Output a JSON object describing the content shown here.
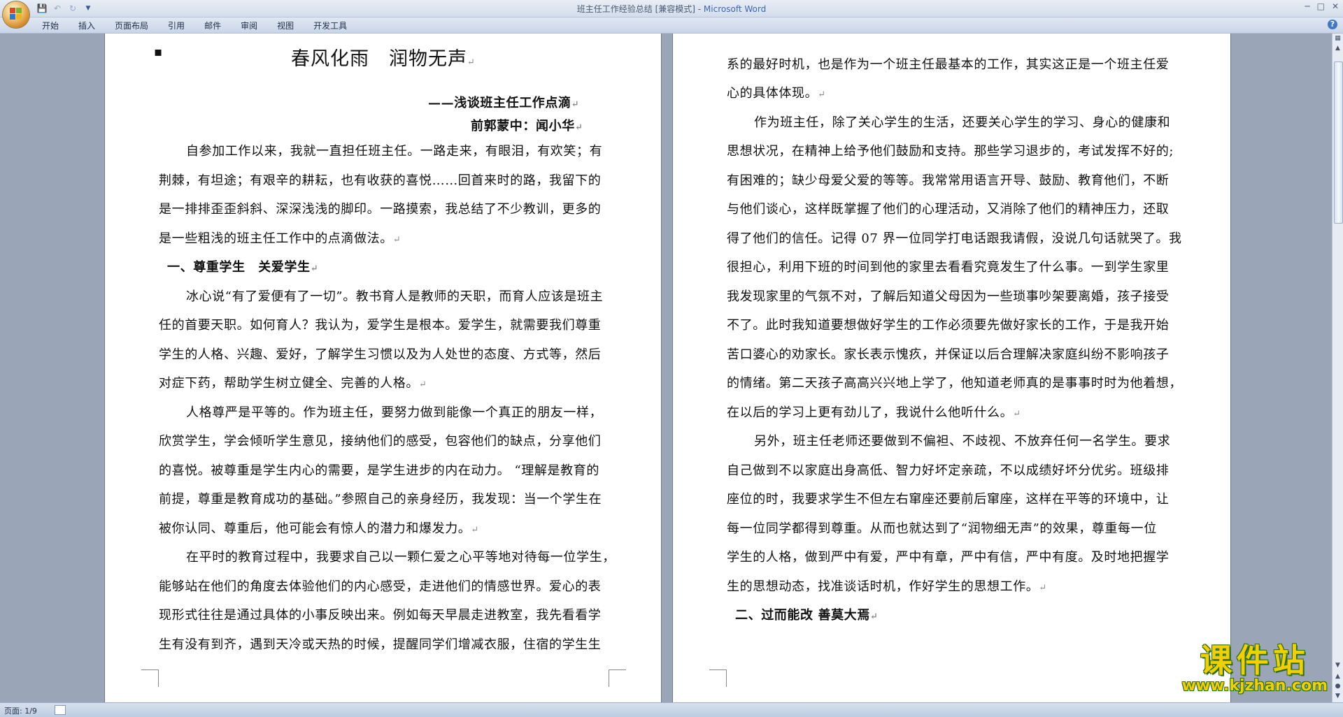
{
  "window": {
    "title_doc": "班主任工作经验总结 [兼容模式] - ",
    "title_app": "Microsoft Word"
  },
  "ribbon": {
    "tabs": [
      "开始",
      "插入",
      "页面布局",
      "引用",
      "邮件",
      "审阅",
      "视图",
      "开发工具"
    ]
  },
  "status": {
    "page": "页面: 1/9"
  },
  "watermark": {
    "text": "课件站",
    "url": "www.kjzhan.com"
  },
  "page_left": {
    "title": "春风化雨　润物无声",
    "subtitle": "——浅谈班主任工作点滴",
    "author": "前郭蒙中：闻小华",
    "lines": [
      "自参加工作以来，我就一直担任班主任。一路走来，有眼泪，有欢笑；有",
      "荆棘，有坦途；有艰辛的耕耘，也有收获的喜悦……回首来时的路，我留下的",
      "是一排排歪歪斜斜、深深浅浅的脚印。一路摸索，我总结了不少教训，更多的",
      "是一些粗浅的班主任工作中的点滴做法。",
      "一、尊重学生　关爱学生",
      "冰心说“有了爱便有了一切”。教书育人是教师的天职，而育人应该是班主",
      "任的首要天职。如何育人？我认为，爱学生是根本。爱学生，就需要我们尊重",
      "学生的人格、兴趣、爱好，了解学生习惯以及为人处世的态度、方式等，然后",
      "对症下药，帮助学生树立健全、完善的人格。",
      "人格尊严是平等的。作为班主任，要努力做到能像一个真正的朋友一样，",
      "欣赏学生，学会倾听学生意见，接纳他们的感受，包容他们的缺点，分享他们",
      "的喜悦。被尊重是学生内心的需要，是学生进步的内在动力。 “理解是教育的",
      "前提，尊重是教育成功的基础。”参照自己的亲身经历，我发现：当一个学生在",
      "被你认同、尊重后，他可能会有惊人的潜力和爆发力。",
      "在平时的教育过程中，我要求自己以一颗仁爱之心平等地对待每一位学生，",
      "能够站在他们的角度去体验他们的内心感受，走进他们的情感世界。爱心的表",
      "现形式往往是通过具体的小事反映出来。例如每天早晨走进教室，我先看看学",
      "生有没有到齐，遇到天冷或天热的时候，提醒同学们增减衣服，住宿的学生生"
    ]
  },
  "page_right": {
    "lines": [
      "系的最好时机，也是作为一个班主任最基本的工作，其实这正是一个班主任爱",
      "心的具体体现。",
      "作为班主任，除了关心学生的生活，还要关心学生的学习、身心的健康和",
      "思想状况，在精神上给予他们鼓励和支持。那些学习退步的，考试发挥不好的;",
      "有困难的；缺少母爱父爱的等等。我常常用语言开导、鼓励、教育他们，不断",
      "与他们谈心，这样既掌握了他们的心理活动，又消除了他们的精神压力，还取",
      "得了他们的信任。记得 07 界一位同学打电话跟我请假，没说几句话就哭了。我",
      "很担心，利用下班的时间到他的家里去看看究竟发生了什么事。一到学生家里",
      "我发现家里的气氛不对，了解后知道父母因为一些琐事吵架要离婚，孩子接受",
      "不了。此时我知道要想做好学生的工作必须要先做好家长的工作，于是我开始",
      "苦口婆心的劝家长。家长表示愧疚，并保证以后合理解决家庭纠纷不影响孩子",
      "的情绪。第二天孩子高高兴兴地上学了，他知道老师真的是事事时时为他着想，",
      "在以后的学习上更有劲儿了，我说什么他听什么。",
      "另外，班主任老师还要做到不偏袒、不歧视、不放弃任何一名学生。要求",
      "自己做到不以家庭出身高低、智力好坏定亲疏，不以成绩好坏分优劣。班级排",
      "座位的时，我要求学生不但左右窜座还要前后窜座，这样在平等的环境中，让",
      "每一位同学都得到尊重。从而也就达到了“润物细无声”的效果，尊重每一位",
      "学生的人格，做到严中有爱，严中有章，严中有信，严中有度。及时地把握学",
      "生的思想动态，找准谈话时机，作好学生的思想工作。",
      "二、过而能改 善莫大焉"
    ]
  }
}
